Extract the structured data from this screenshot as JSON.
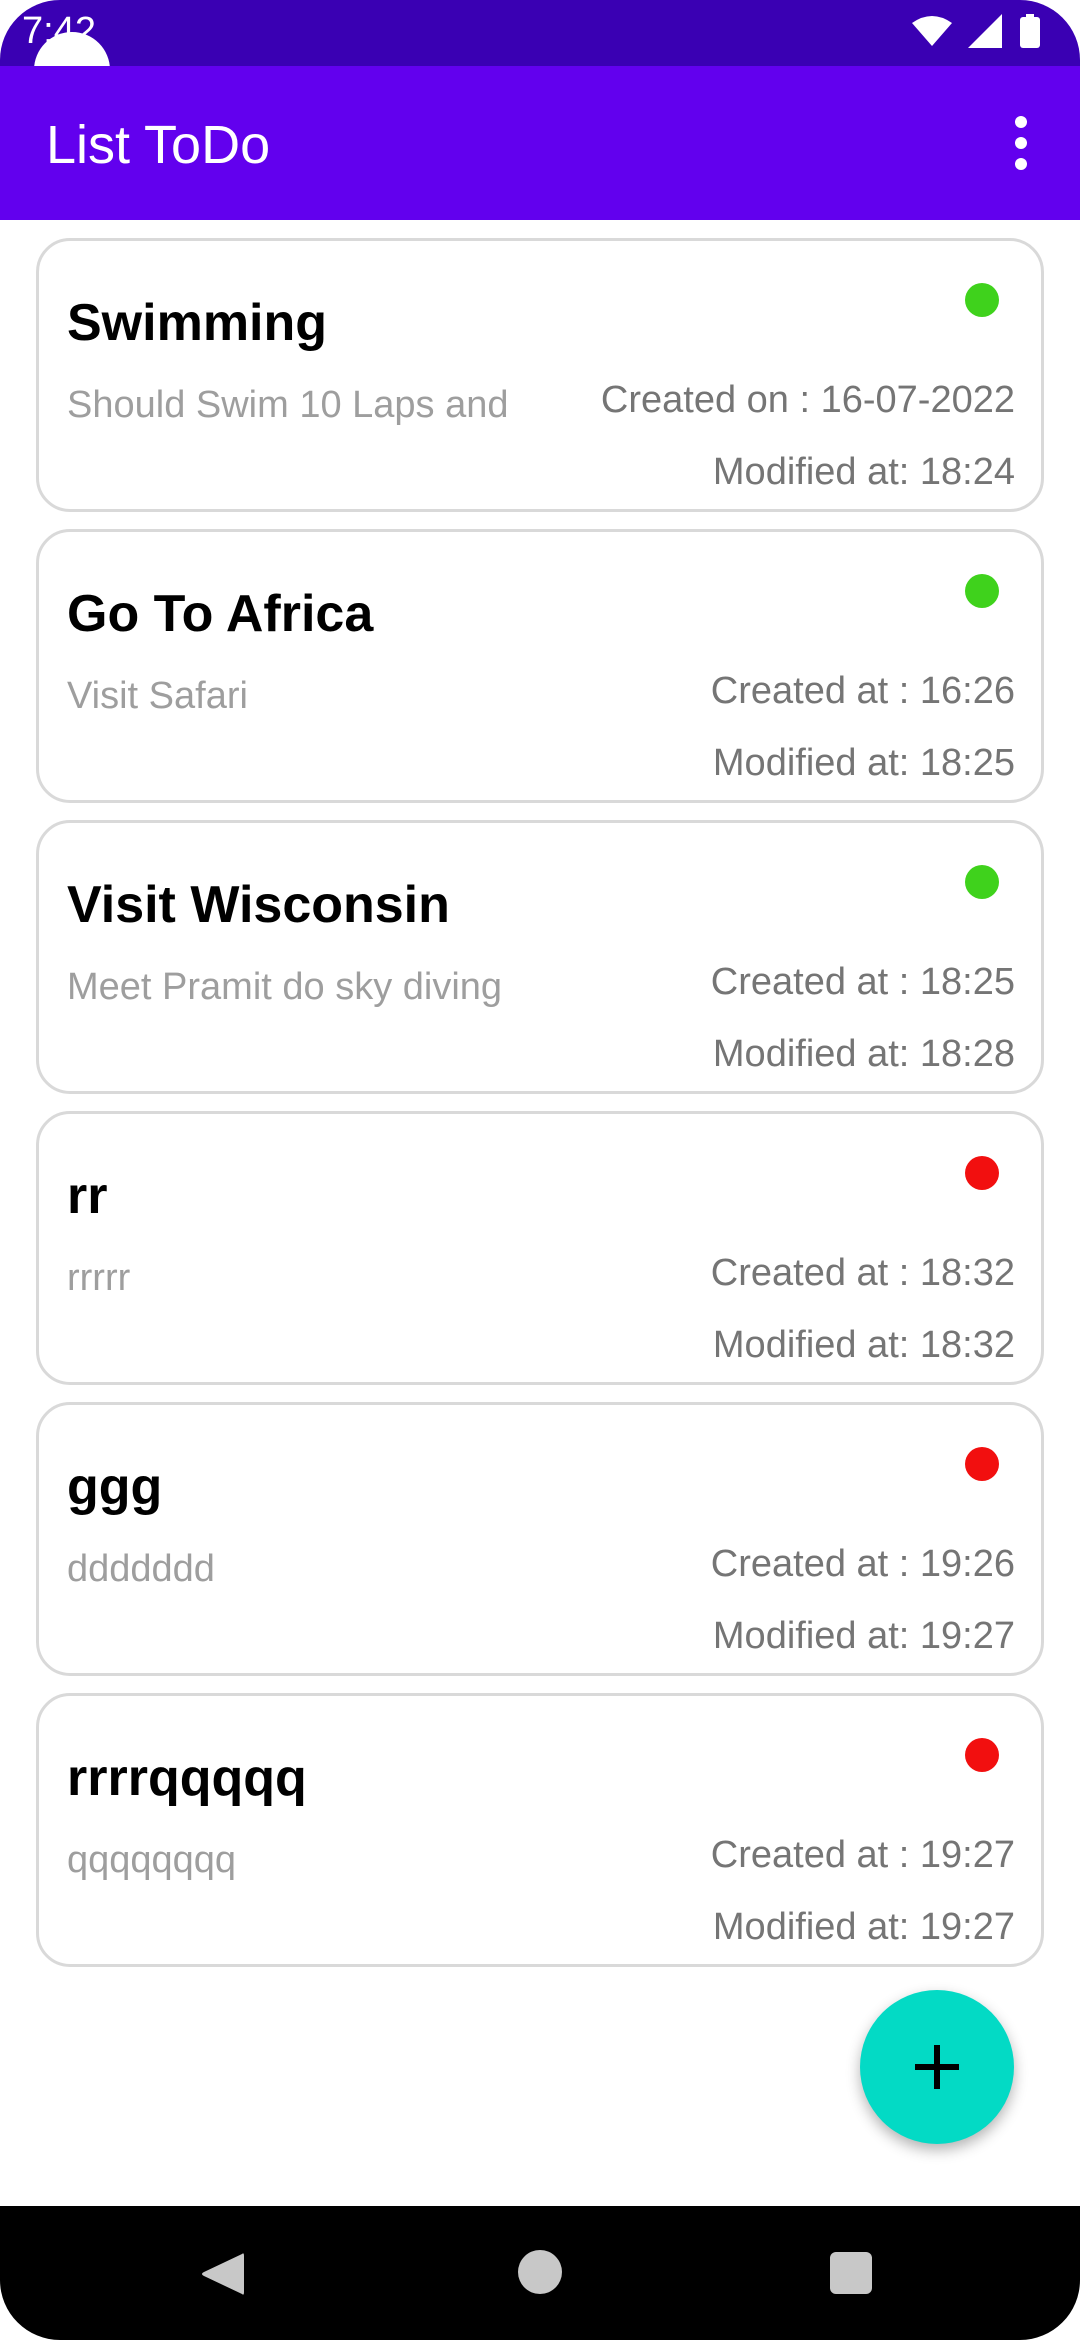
{
  "status_bar": {
    "time": "7:42"
  },
  "app_bar": {
    "title": "List ToDo"
  },
  "todos": [
    {
      "title": "Swimming",
      "description": "Should Swim 10 Laps and",
      "created": "Created on : 16-07-2022",
      "modified": "Modified at: 18:24",
      "status_color": "#3fd21c"
    },
    {
      "title": "Go To Africa",
      "description": "Visit Safari",
      "created": "Created at : 16:26",
      "modified": "Modified at: 18:25",
      "status_color": "#3fd21c"
    },
    {
      "title": "Visit Wisconsin",
      "description": "Meet Pramit do sky diving",
      "created": "Created at : 18:25",
      "modified": "Modified at: 18:28",
      "status_color": "#3fd21c"
    },
    {
      "title": "rr",
      "description": "rrrrr",
      "created": "Created at : 18:32",
      "modified": "Modified at: 18:32",
      "status_color": "#f20f0f"
    },
    {
      "title": "ggg",
      "description": "ddddddd",
      "created": "Created at : 19:26",
      "modified": "Modified at: 19:27",
      "status_color": "#f20f0f"
    },
    {
      "title": "rrrrqqqqq",
      "description": "qqqqqqqq",
      "created": "Created at : 19:27",
      "modified": "Modified at: 19:27",
      "status_color": "#f20f0f"
    }
  ],
  "fab": {
    "icon": "plus-icon",
    "color": "#03dac5"
  },
  "colors": {
    "app_bar": "#6200ee",
    "status_bar": "#3a00b3"
  },
  "nav_bar": {
    "back_icon": "back-triangle-icon",
    "home_icon": "home-circle-icon",
    "recents_icon": "recents-square-icon"
  }
}
